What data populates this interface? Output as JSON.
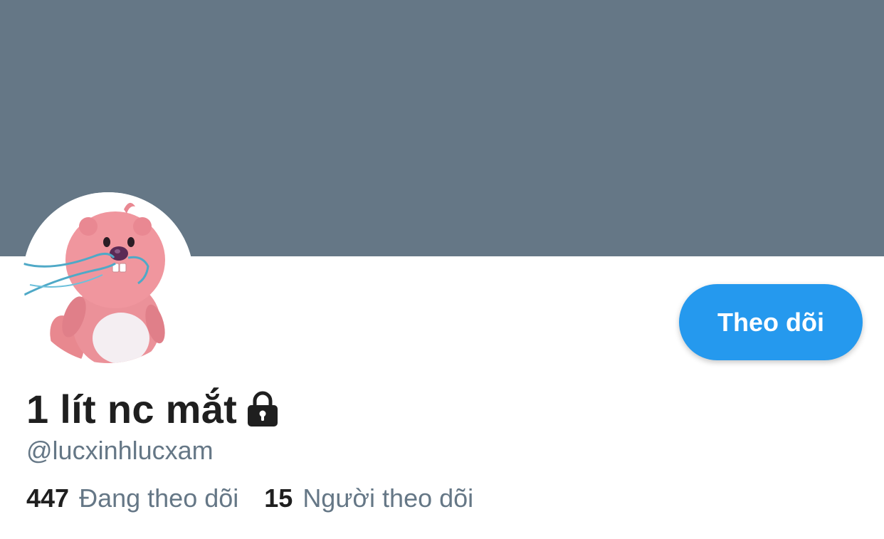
{
  "profile": {
    "display_name": "1 lít nc mắt",
    "handle": "@lucxinhlucxam",
    "protected": true,
    "lock_icon": "lock-icon",
    "avatar_icon": "pink-beaver-avatar"
  },
  "actions": {
    "follow_label": "Theo dõi"
  },
  "stats": {
    "following_count": "447",
    "following_label": "Đang theo dõi",
    "followers_count": "15",
    "followers_label": "Người theo dõi"
  },
  "colors": {
    "banner": "#657786",
    "accent": "#1da1f2",
    "follow_button": "#2599ee",
    "text_primary": "#1f1f1f",
    "text_secondary": "#657786"
  }
}
